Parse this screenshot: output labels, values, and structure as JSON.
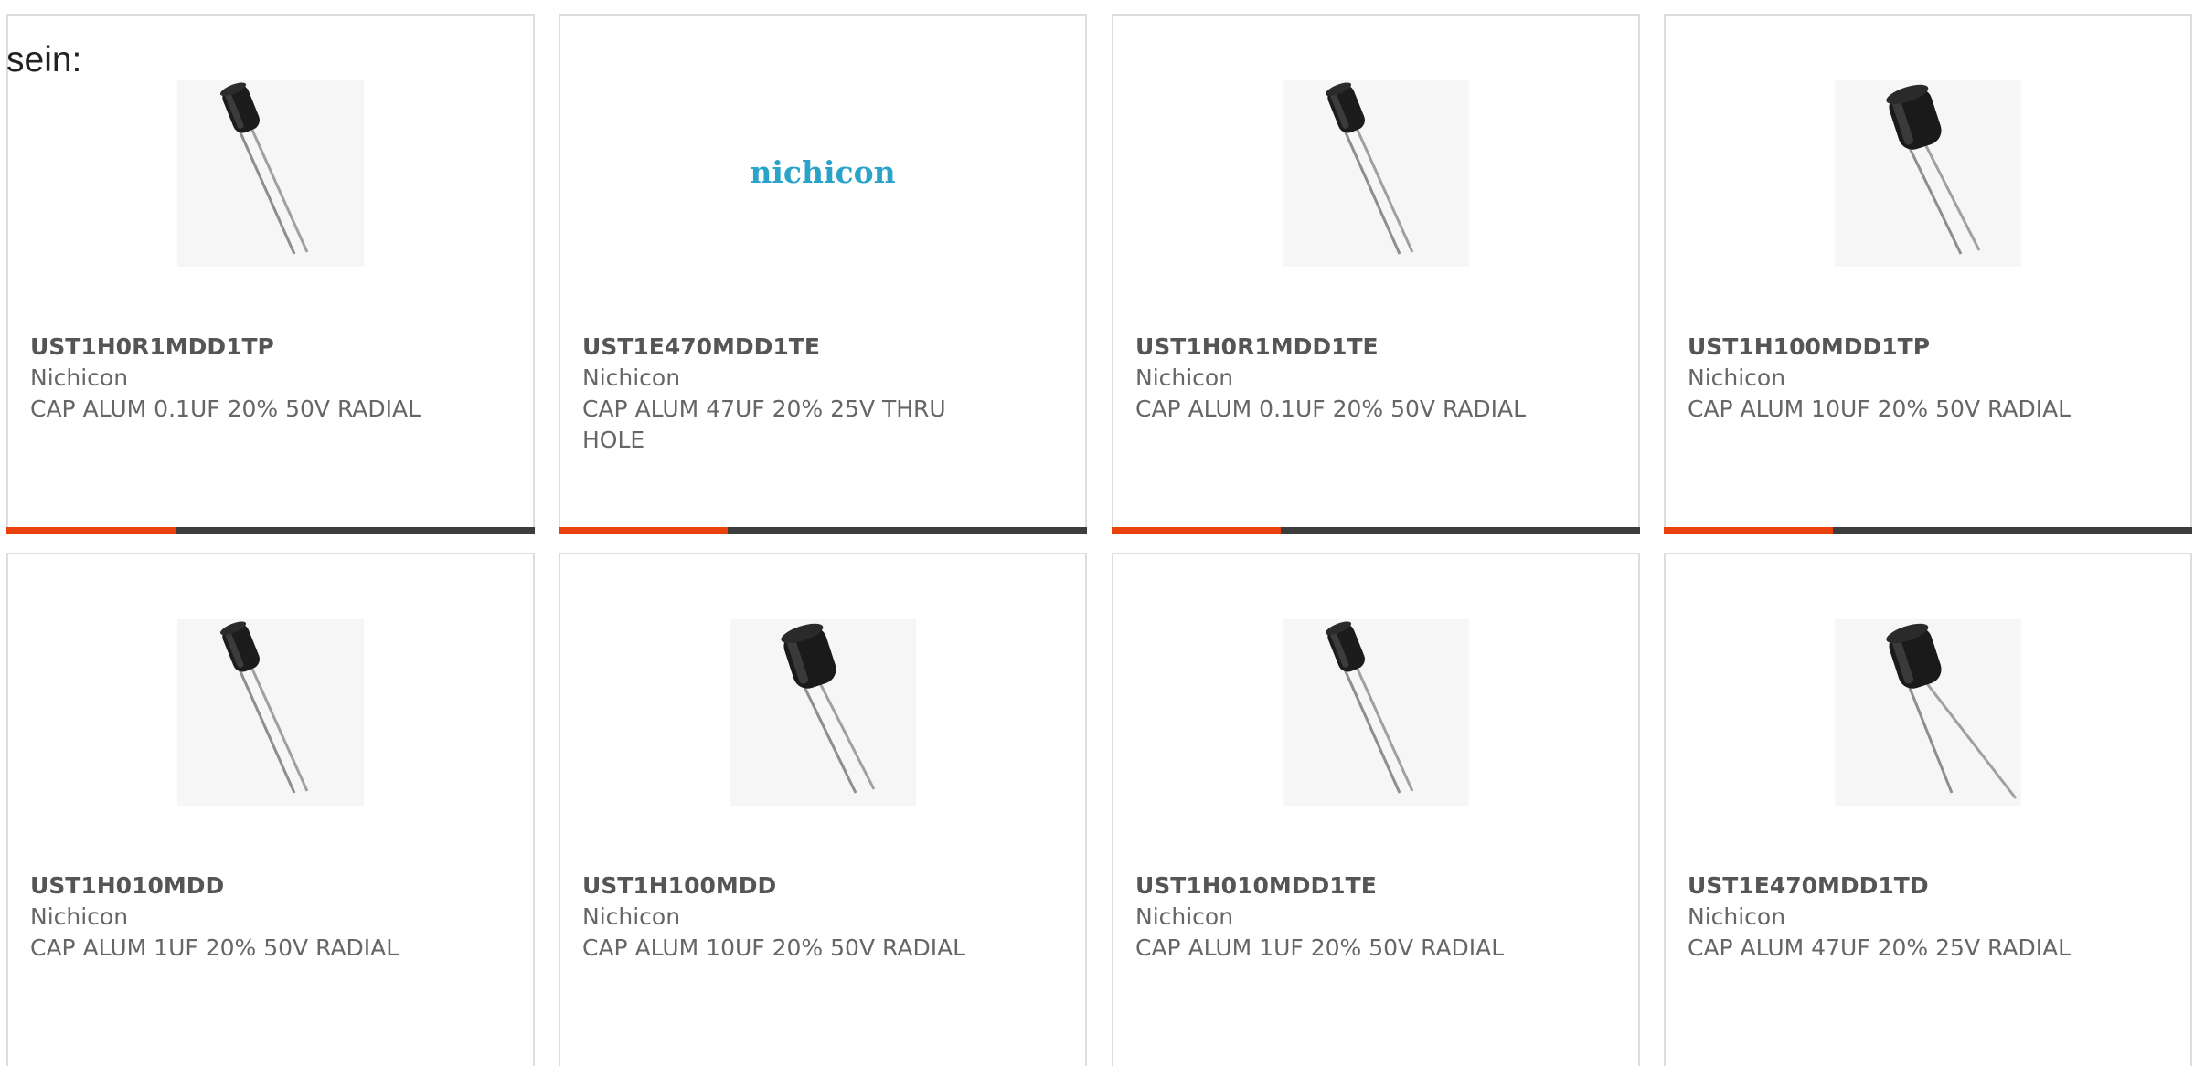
{
  "lead_text": "sein:",
  "colors": {
    "accent": "#e8410c",
    "bar_track": "#3d3d3d",
    "card_border": "#dddddd",
    "brand_logo": "#2aa3c9"
  },
  "products": [
    {
      "part_number": "UST1H0R1MDD1TP",
      "manufacturer": "Nichicon",
      "description": "CAP ALUM 0.1UF 20% 50V RADIAL",
      "image": "capacitor-small-icon",
      "bar_fill": 0.32
    },
    {
      "part_number": "UST1E470MDD1TE",
      "manufacturer": "Nichicon",
      "description": "CAP ALUM 47UF 20% 25V THRU HOLE",
      "image": "nichicon-logo",
      "logo_text": "nichicon",
      "bar_fill": 0.32
    },
    {
      "part_number": "UST1H0R1MDD1TE",
      "manufacturer": "Nichicon",
      "description": "CAP ALUM 0.1UF 20% 50V RADIAL",
      "image": "capacitor-small-icon",
      "bar_fill": 0.32
    },
    {
      "part_number": "UST1H100MDD1TP",
      "manufacturer": "Nichicon",
      "description": "CAP ALUM 10UF 20% 50V RADIAL",
      "image": "capacitor-large-icon",
      "bar_fill": 0.32
    },
    {
      "part_number": "UST1H010MDD",
      "manufacturer": "Nichicon",
      "description": "CAP ALUM 1UF 20% 50V RADIAL",
      "image": "capacitor-small-icon"
    },
    {
      "part_number": "UST1H100MDD",
      "manufacturer": "Nichicon",
      "description": "CAP ALUM 10UF 20% 50V RADIAL",
      "image": "capacitor-large-icon"
    },
    {
      "part_number": "UST1H010MDD1TE",
      "manufacturer": "Nichicon",
      "description": "CAP ALUM 1UF 20% 50V RADIAL",
      "image": "capacitor-small-icon"
    },
    {
      "part_number": "UST1E470MDD1TD",
      "manufacturer": "Nichicon",
      "description": "CAP ALUM 47UF 20% 25V RADIAL",
      "image": "capacitor-large-icon"
    }
  ]
}
